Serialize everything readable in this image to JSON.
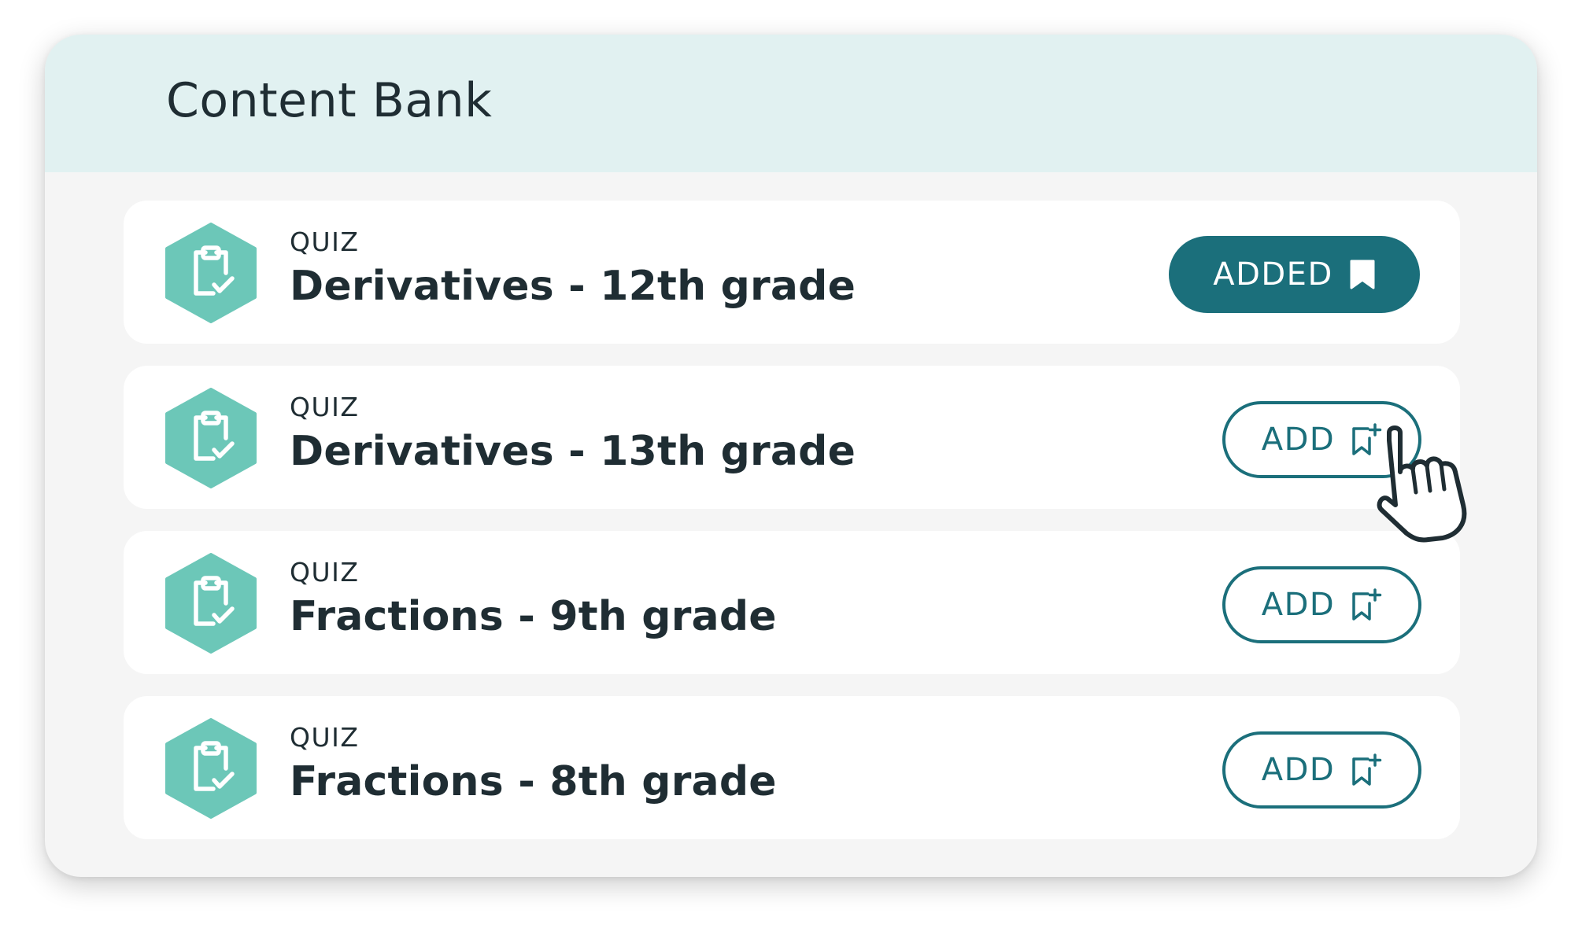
{
  "panel": {
    "title": "Content Bank"
  },
  "items": [
    {
      "type": "QUIZ",
      "title": "Derivatives - 12th grade",
      "action_label": "ADDED",
      "state": "added"
    },
    {
      "type": "QUIZ",
      "title": "Derivatives - 13th grade",
      "action_label": "ADD",
      "state": "not-added"
    },
    {
      "type": "QUIZ",
      "title": "Fractions - 9th grade",
      "action_label": "ADD",
      "state": "not-added"
    },
    {
      "type": "QUIZ",
      "title": "Fractions - 8th grade",
      "action_label": "ADD",
      "state": "not-added"
    }
  ],
  "icons": {
    "item_icon": "clipboard-check-icon",
    "added_icon": "bookmark-filled-icon",
    "add_icon": "bookmark-add-icon",
    "pointer": "hand-pointer-cursor"
  },
  "colors": {
    "header_bg": "#e1f1f1",
    "panel_bg": "#f5f5f5",
    "accent": "#1b6f7b",
    "hexagon": "#6cc7b8",
    "text": "#1f2d33"
  }
}
